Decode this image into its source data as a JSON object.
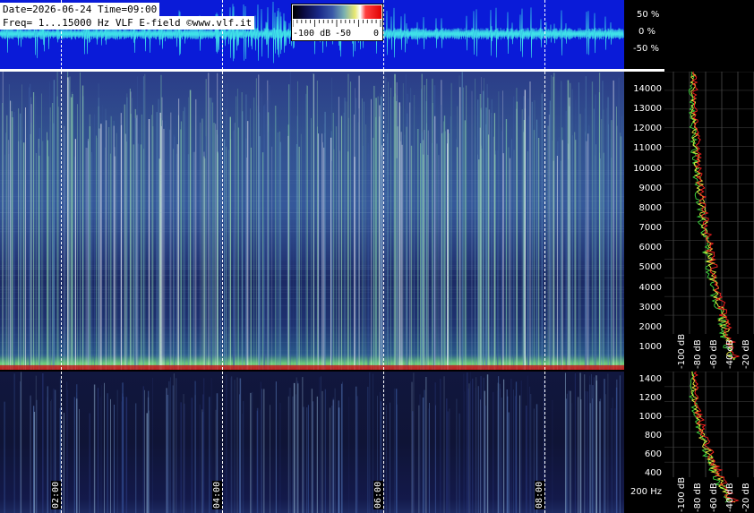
{
  "header": {
    "line1": "Date=2026-06-24 Time=09:00",
    "line2": "Freq= 1...15000 Hz   VLF E-field ©www.vlf.it"
  },
  "colorbar": {
    "labels": [
      "-100 dB",
      "-50",
      "0"
    ]
  },
  "amplitude_scale": [
    "50 %",
    "0 %",
    "-50 %"
  ],
  "freq_axis_high": [
    "14000",
    "13000",
    "12000",
    "11000",
    "10000",
    "9000",
    "8000",
    "7000",
    "6000",
    "5000",
    "4000",
    "3000",
    "2000",
    "1000"
  ],
  "freq_axis_low": [
    "1400",
    "1200",
    "1000",
    "800",
    "600",
    "400",
    "200 Hz"
  ],
  "db_labels_high": [
    "-100 dB",
    "-80 dB",
    "-60 dB",
    "-40 dB",
    "-20 dB"
  ],
  "db_labels_low": [
    "-100 dB",
    "-80 dB",
    "-60 dB",
    "-40 dB",
    "-20 dB"
  ],
  "time_labels": [
    "02:00",
    "04:00",
    "06:00",
    "08:00"
  ],
  "colors": {
    "wave_bg": "#0a1bd8",
    "wave_line": "#3fe0e8",
    "profile_red": "#ff2020",
    "profile_yellow": "#f0f040",
    "profile_green": "#40e040"
  }
}
